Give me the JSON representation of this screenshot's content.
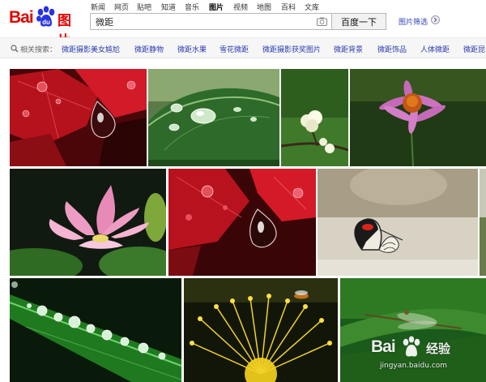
{
  "logo": {
    "text_bai": "Bai",
    "text_images": "图片"
  },
  "nav": {
    "items": [
      "新闻",
      "网页",
      "贴吧",
      "知道",
      "音乐",
      "图片",
      "视频",
      "地图",
      "百科",
      "文库"
    ],
    "active": "图片"
  },
  "search": {
    "query": "微距",
    "button_label": "百度一下",
    "filter_label": "图片筛选"
  },
  "related": {
    "label": "相关搜索：",
    "items": [
      "微距摄影美女尴尬",
      "微距静物",
      "微距水果",
      "雪花微距",
      "微距摄影获奖图片",
      "微距背景",
      "微距饰品",
      "人体微距",
      "微距昆"
    ]
  },
  "images": [
    {
      "label": "red-leaf-water-drop"
    },
    {
      "label": "green-leaf-water-drops"
    },
    {
      "label": "white-blossom"
    },
    {
      "label": "purple-coneflower"
    },
    {
      "label": "pink-lotus"
    },
    {
      "label": "red-leaf-water-drop-2"
    },
    {
      "label": "butterfly"
    },
    {
      "label": "leaf-edge"
    },
    {
      "label": "green-grass-dew"
    },
    {
      "label": "yellow-stamens-hoverfly"
    },
    {
      "label": "damselfly"
    }
  ],
  "watermark": {
    "brand": "Bai",
    "suffix": "经验",
    "url": "jingyan.baidu.com"
  },
  "colors": {
    "brand_red": "#e10602",
    "link_blue": "#2a3bb0"
  }
}
